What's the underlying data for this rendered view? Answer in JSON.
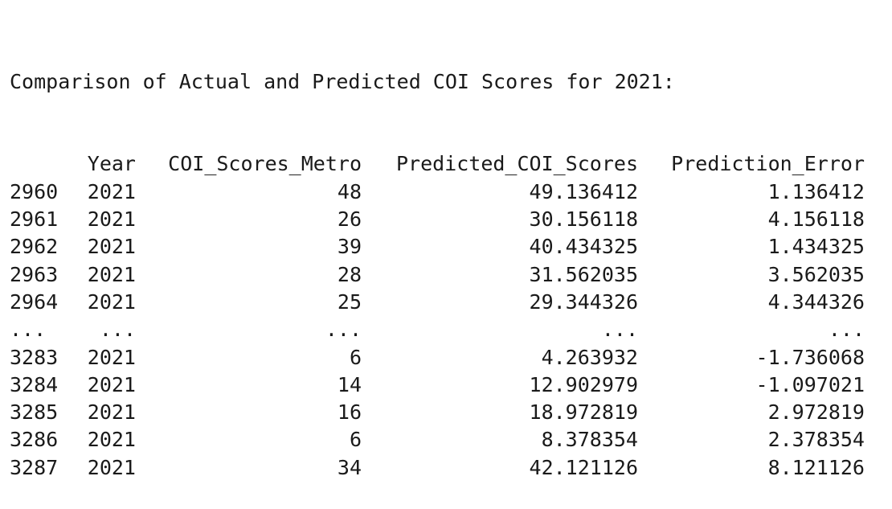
{
  "heading": "Comparison of Actual and Predicted COI Scores for 2021:",
  "columns": [
    "",
    "Year",
    "COI_Scores_Metro",
    "Predicted_COI_Scores",
    "Prediction_Error"
  ],
  "rows": [
    [
      "2960",
      "2021",
      "48",
      "49.136412",
      "1.136412"
    ],
    [
      "2961",
      "2021",
      "26",
      "30.156118",
      "4.156118"
    ],
    [
      "2962",
      "2021",
      "39",
      "40.434325",
      "1.434325"
    ],
    [
      "2963",
      "2021",
      "28",
      "31.562035",
      "3.562035"
    ],
    [
      "2964",
      "2021",
      "25",
      "29.344326",
      "4.344326"
    ],
    [
      "...",
      "...",
      "...",
      "...",
      "..."
    ],
    [
      "3283",
      "2021",
      "6",
      "4.263932",
      "-1.736068"
    ],
    [
      "3284",
      "2021",
      "14",
      "12.902979",
      "-1.097021"
    ],
    [
      "3285",
      "2021",
      "16",
      "18.972819",
      "2.972819"
    ],
    [
      "3286",
      "2021",
      "6",
      "8.378354",
      "2.378354"
    ],
    [
      "3287",
      "2021",
      "34",
      "42.121126",
      "8.121126"
    ]
  ]
}
